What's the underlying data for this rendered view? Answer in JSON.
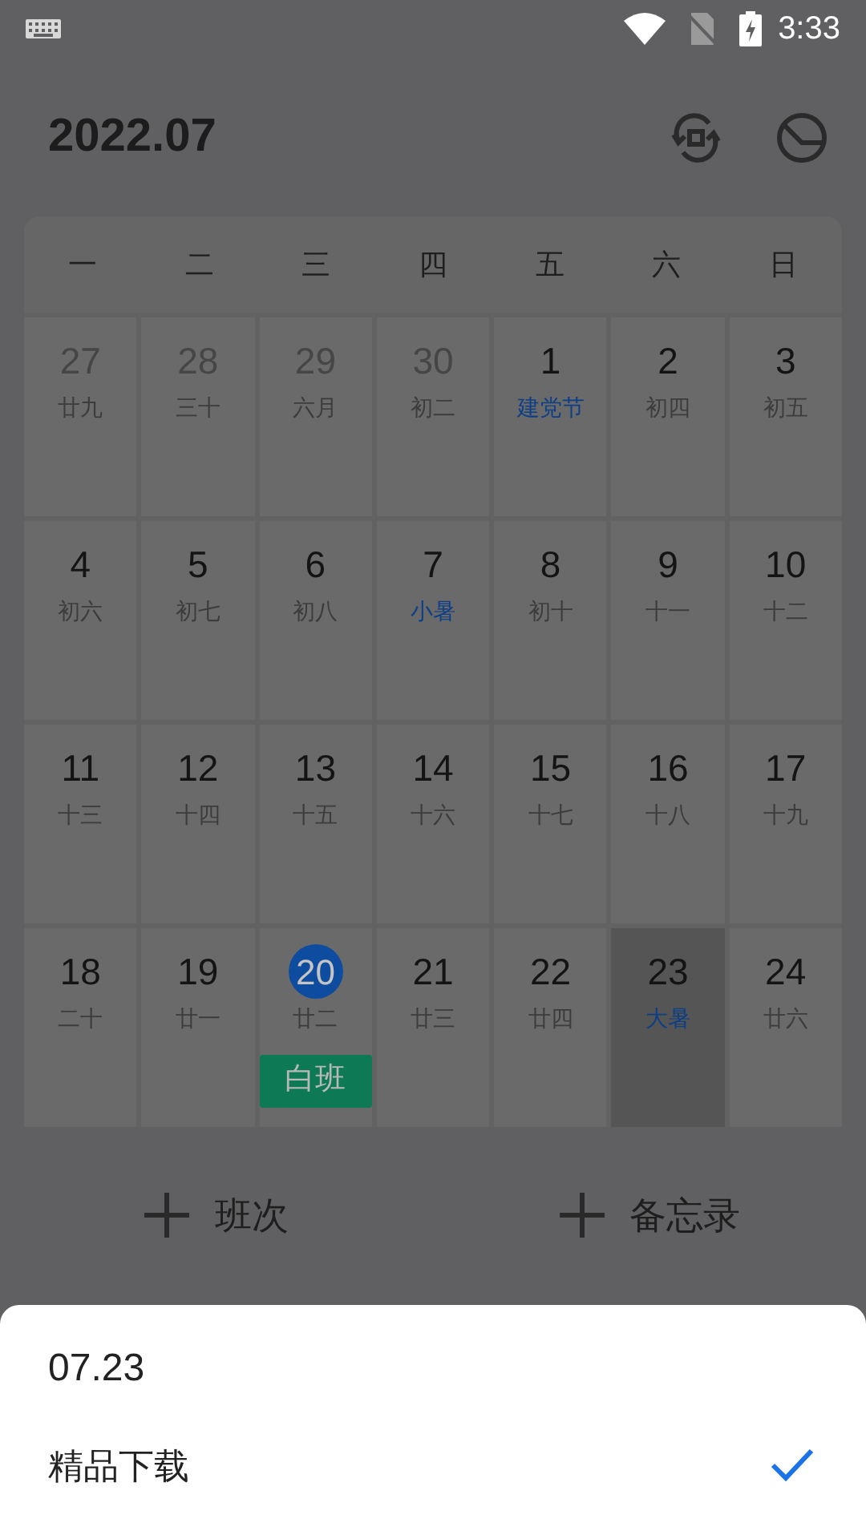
{
  "status_bar": {
    "time": "3:33"
  },
  "header": {
    "title": "2022.07"
  },
  "weekdays": [
    "一",
    "二",
    "三",
    "四",
    "五",
    "六",
    "日"
  ],
  "days": [
    {
      "day": "27",
      "lunar": "廿九",
      "other_month": true,
      "festival": false,
      "today": false,
      "selected": false
    },
    {
      "day": "28",
      "lunar": "三十",
      "other_month": true,
      "festival": false,
      "today": false,
      "selected": false
    },
    {
      "day": "29",
      "lunar": "六月",
      "other_month": true,
      "festival": false,
      "today": false,
      "selected": false
    },
    {
      "day": "30",
      "lunar": "初二",
      "other_month": true,
      "festival": false,
      "today": false,
      "selected": false
    },
    {
      "day": "1",
      "lunar": "建党节",
      "other_month": false,
      "festival": true,
      "today": false,
      "selected": false
    },
    {
      "day": "2",
      "lunar": "初四",
      "other_month": false,
      "festival": false,
      "today": false,
      "selected": false
    },
    {
      "day": "3",
      "lunar": "初五",
      "other_month": false,
      "festival": false,
      "today": false,
      "selected": false
    },
    {
      "day": "4",
      "lunar": "初六",
      "other_month": false,
      "festival": false,
      "today": false,
      "selected": false
    },
    {
      "day": "5",
      "lunar": "初七",
      "other_month": false,
      "festival": false,
      "today": false,
      "selected": false
    },
    {
      "day": "6",
      "lunar": "初八",
      "other_month": false,
      "festival": false,
      "today": false,
      "selected": false
    },
    {
      "day": "7",
      "lunar": "小暑",
      "other_month": false,
      "festival": true,
      "today": false,
      "selected": false
    },
    {
      "day": "8",
      "lunar": "初十",
      "other_month": false,
      "festival": false,
      "today": false,
      "selected": false
    },
    {
      "day": "9",
      "lunar": "十一",
      "other_month": false,
      "festival": false,
      "today": false,
      "selected": false
    },
    {
      "day": "10",
      "lunar": "十二",
      "other_month": false,
      "festival": false,
      "today": false,
      "selected": false
    },
    {
      "day": "11",
      "lunar": "十三",
      "other_month": false,
      "festival": false,
      "today": false,
      "selected": false
    },
    {
      "day": "12",
      "lunar": "十四",
      "other_month": false,
      "festival": false,
      "today": false,
      "selected": false
    },
    {
      "day": "13",
      "lunar": "十五",
      "other_month": false,
      "festival": false,
      "today": false,
      "selected": false
    },
    {
      "day": "14",
      "lunar": "十六",
      "other_month": false,
      "festival": false,
      "today": false,
      "selected": false
    },
    {
      "day": "15",
      "lunar": "十七",
      "other_month": false,
      "festival": false,
      "today": false,
      "selected": false
    },
    {
      "day": "16",
      "lunar": "十八",
      "other_month": false,
      "festival": false,
      "today": false,
      "selected": false
    },
    {
      "day": "17",
      "lunar": "十九",
      "other_month": false,
      "festival": false,
      "today": false,
      "selected": false
    },
    {
      "day": "18",
      "lunar": "二十",
      "other_month": false,
      "festival": false,
      "today": false,
      "selected": false
    },
    {
      "day": "19",
      "lunar": "廿一",
      "other_month": false,
      "festival": false,
      "today": false,
      "selected": false
    },
    {
      "day": "20",
      "lunar": "廿二",
      "other_month": false,
      "festival": false,
      "today": true,
      "selected": false,
      "shift": {
        "label": "白班",
        "color": "#0e7a55"
      }
    },
    {
      "day": "21",
      "lunar": "廿三",
      "other_month": false,
      "festival": false,
      "today": false,
      "selected": false
    },
    {
      "day": "22",
      "lunar": "廿四",
      "other_month": false,
      "festival": false,
      "today": false,
      "selected": false
    },
    {
      "day": "23",
      "lunar": "大暑",
      "other_month": false,
      "festival": true,
      "today": false,
      "selected": true
    },
    {
      "day": "24",
      "lunar": "廿六",
      "other_month": false,
      "festival": false,
      "today": false,
      "selected": false
    }
  ],
  "actions": [
    "班次",
    "备忘录"
  ],
  "sheet": {
    "title": "07.23",
    "options": [
      {
        "label": "精品下载",
        "selected": true
      }
    ]
  }
}
